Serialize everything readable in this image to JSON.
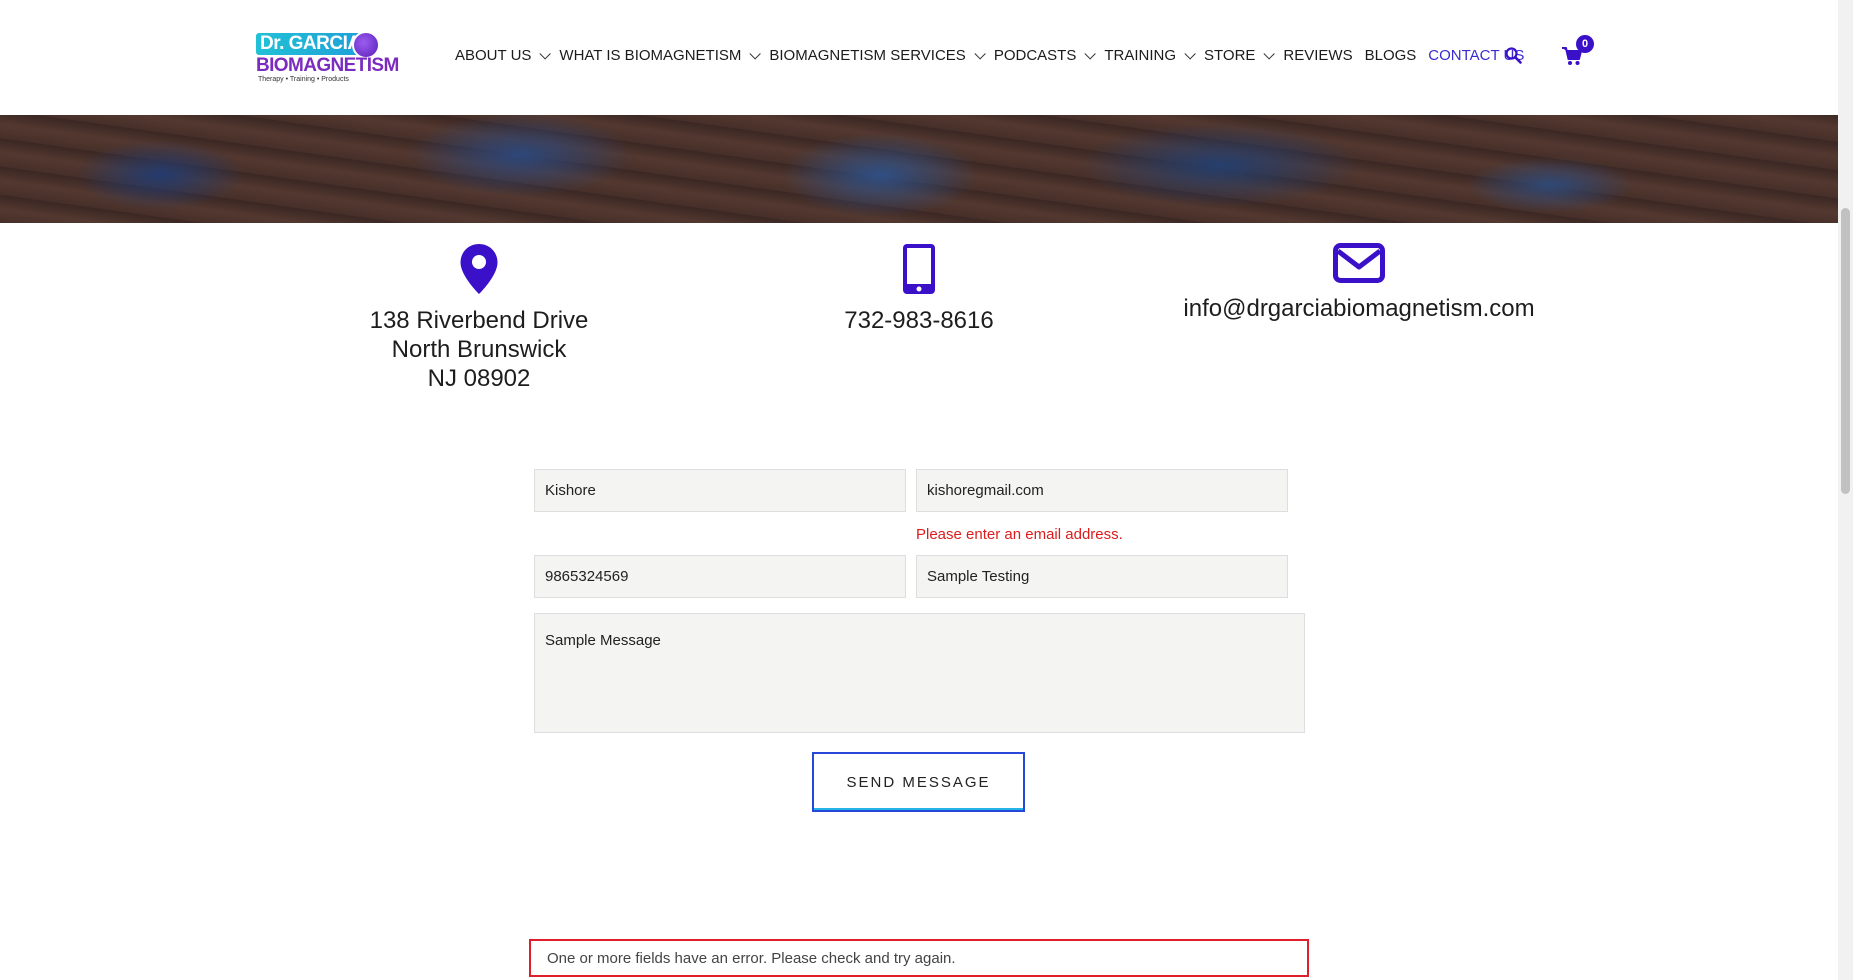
{
  "header": {
    "logo": {
      "line1": "Dr. GARCIA",
      "line2": "BIOMAGNETISM",
      "tagline": "Therapy • Training • Products"
    },
    "nav": [
      {
        "label": "ABOUT US",
        "has_dropdown": true
      },
      {
        "label": "WHAT IS BIOMAGNETISM",
        "has_dropdown": true
      },
      {
        "label": "BIOMAGNETISM SERVICES",
        "has_dropdown": true
      },
      {
        "label": "PODCASTS",
        "has_dropdown": true
      },
      {
        "label": "TRAINING",
        "has_dropdown": true
      },
      {
        "label": "STORE",
        "has_dropdown": true
      },
      {
        "label": "REVIEWS",
        "has_dropdown": false
      },
      {
        "label": "BLOGS",
        "has_dropdown": false
      },
      {
        "label": "CONTACT US",
        "has_dropdown": false,
        "active": true
      }
    ],
    "search_icon": "search-icon",
    "cart": {
      "icon": "cart-icon",
      "count": "0"
    }
  },
  "contact": {
    "address": {
      "icon": "map-pin-icon",
      "lines": [
        "138 Riverbend Drive",
        "North Brunswick",
        "NJ 08902"
      ]
    },
    "phone": {
      "icon": "mobile-phone-icon",
      "value": "732-983-8616"
    },
    "email": {
      "icon": "envelope-icon",
      "value": "info@drgarciabiomagnetism.com"
    }
  },
  "form": {
    "name_value": "Kishore",
    "email_value": "kishoregmail.com",
    "email_error": "Please enter an email address.",
    "phone_value": "9865324569",
    "subject_value": "Sample Testing",
    "message_value": "Sample Message",
    "submit_label": "SEND MESSAGE",
    "form_error": "One or more fields have an error. Please check and try again."
  },
  "colors": {
    "accent": "#3a10c8",
    "error": "#dc1d1d",
    "field_bg": "#f4f4f3"
  }
}
